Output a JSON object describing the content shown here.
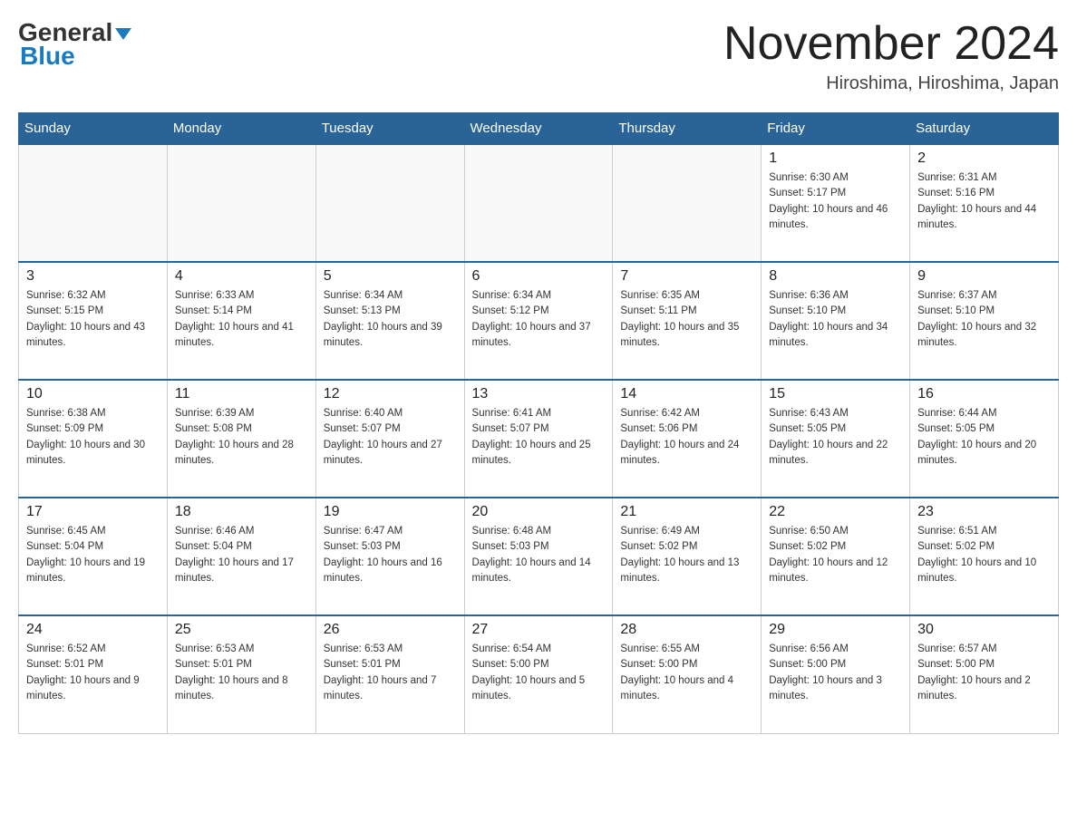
{
  "header": {
    "logo_general": "General",
    "logo_blue": "Blue",
    "month_title": "November 2024",
    "location": "Hiroshima, Hiroshima, Japan"
  },
  "days_of_week": [
    "Sunday",
    "Monday",
    "Tuesday",
    "Wednesday",
    "Thursday",
    "Friday",
    "Saturday"
  ],
  "weeks": [
    {
      "days": [
        {
          "number": "",
          "sunrise": "",
          "sunset": "",
          "daylight": "",
          "empty": true
        },
        {
          "number": "",
          "sunrise": "",
          "sunset": "",
          "daylight": "",
          "empty": true
        },
        {
          "number": "",
          "sunrise": "",
          "sunset": "",
          "daylight": "",
          "empty": true
        },
        {
          "number": "",
          "sunrise": "",
          "sunset": "",
          "daylight": "",
          "empty": true
        },
        {
          "number": "",
          "sunrise": "",
          "sunset": "",
          "daylight": "",
          "empty": true
        },
        {
          "number": "1",
          "sunrise": "Sunrise: 6:30 AM",
          "sunset": "Sunset: 5:17 PM",
          "daylight": "Daylight: 10 hours and 46 minutes.",
          "empty": false
        },
        {
          "number": "2",
          "sunrise": "Sunrise: 6:31 AM",
          "sunset": "Sunset: 5:16 PM",
          "daylight": "Daylight: 10 hours and 44 minutes.",
          "empty": false
        }
      ]
    },
    {
      "days": [
        {
          "number": "3",
          "sunrise": "Sunrise: 6:32 AM",
          "sunset": "Sunset: 5:15 PM",
          "daylight": "Daylight: 10 hours and 43 minutes.",
          "empty": false
        },
        {
          "number": "4",
          "sunrise": "Sunrise: 6:33 AM",
          "sunset": "Sunset: 5:14 PM",
          "daylight": "Daylight: 10 hours and 41 minutes.",
          "empty": false
        },
        {
          "number": "5",
          "sunrise": "Sunrise: 6:34 AM",
          "sunset": "Sunset: 5:13 PM",
          "daylight": "Daylight: 10 hours and 39 minutes.",
          "empty": false
        },
        {
          "number": "6",
          "sunrise": "Sunrise: 6:34 AM",
          "sunset": "Sunset: 5:12 PM",
          "daylight": "Daylight: 10 hours and 37 minutes.",
          "empty": false
        },
        {
          "number": "7",
          "sunrise": "Sunrise: 6:35 AM",
          "sunset": "Sunset: 5:11 PM",
          "daylight": "Daylight: 10 hours and 35 minutes.",
          "empty": false
        },
        {
          "number": "8",
          "sunrise": "Sunrise: 6:36 AM",
          "sunset": "Sunset: 5:10 PM",
          "daylight": "Daylight: 10 hours and 34 minutes.",
          "empty": false
        },
        {
          "number": "9",
          "sunrise": "Sunrise: 6:37 AM",
          "sunset": "Sunset: 5:10 PM",
          "daylight": "Daylight: 10 hours and 32 minutes.",
          "empty": false
        }
      ]
    },
    {
      "days": [
        {
          "number": "10",
          "sunrise": "Sunrise: 6:38 AM",
          "sunset": "Sunset: 5:09 PM",
          "daylight": "Daylight: 10 hours and 30 minutes.",
          "empty": false
        },
        {
          "number": "11",
          "sunrise": "Sunrise: 6:39 AM",
          "sunset": "Sunset: 5:08 PM",
          "daylight": "Daylight: 10 hours and 28 minutes.",
          "empty": false
        },
        {
          "number": "12",
          "sunrise": "Sunrise: 6:40 AM",
          "sunset": "Sunset: 5:07 PM",
          "daylight": "Daylight: 10 hours and 27 minutes.",
          "empty": false
        },
        {
          "number": "13",
          "sunrise": "Sunrise: 6:41 AM",
          "sunset": "Sunset: 5:07 PM",
          "daylight": "Daylight: 10 hours and 25 minutes.",
          "empty": false
        },
        {
          "number": "14",
          "sunrise": "Sunrise: 6:42 AM",
          "sunset": "Sunset: 5:06 PM",
          "daylight": "Daylight: 10 hours and 24 minutes.",
          "empty": false
        },
        {
          "number": "15",
          "sunrise": "Sunrise: 6:43 AM",
          "sunset": "Sunset: 5:05 PM",
          "daylight": "Daylight: 10 hours and 22 minutes.",
          "empty": false
        },
        {
          "number": "16",
          "sunrise": "Sunrise: 6:44 AM",
          "sunset": "Sunset: 5:05 PM",
          "daylight": "Daylight: 10 hours and 20 minutes.",
          "empty": false
        }
      ]
    },
    {
      "days": [
        {
          "number": "17",
          "sunrise": "Sunrise: 6:45 AM",
          "sunset": "Sunset: 5:04 PM",
          "daylight": "Daylight: 10 hours and 19 minutes.",
          "empty": false
        },
        {
          "number": "18",
          "sunrise": "Sunrise: 6:46 AM",
          "sunset": "Sunset: 5:04 PM",
          "daylight": "Daylight: 10 hours and 17 minutes.",
          "empty": false
        },
        {
          "number": "19",
          "sunrise": "Sunrise: 6:47 AM",
          "sunset": "Sunset: 5:03 PM",
          "daylight": "Daylight: 10 hours and 16 minutes.",
          "empty": false
        },
        {
          "number": "20",
          "sunrise": "Sunrise: 6:48 AM",
          "sunset": "Sunset: 5:03 PM",
          "daylight": "Daylight: 10 hours and 14 minutes.",
          "empty": false
        },
        {
          "number": "21",
          "sunrise": "Sunrise: 6:49 AM",
          "sunset": "Sunset: 5:02 PM",
          "daylight": "Daylight: 10 hours and 13 minutes.",
          "empty": false
        },
        {
          "number": "22",
          "sunrise": "Sunrise: 6:50 AM",
          "sunset": "Sunset: 5:02 PM",
          "daylight": "Daylight: 10 hours and 12 minutes.",
          "empty": false
        },
        {
          "number": "23",
          "sunrise": "Sunrise: 6:51 AM",
          "sunset": "Sunset: 5:02 PM",
          "daylight": "Daylight: 10 hours and 10 minutes.",
          "empty": false
        }
      ]
    },
    {
      "days": [
        {
          "number": "24",
          "sunrise": "Sunrise: 6:52 AM",
          "sunset": "Sunset: 5:01 PM",
          "daylight": "Daylight: 10 hours and 9 minutes.",
          "empty": false
        },
        {
          "number": "25",
          "sunrise": "Sunrise: 6:53 AM",
          "sunset": "Sunset: 5:01 PM",
          "daylight": "Daylight: 10 hours and 8 minutes.",
          "empty": false
        },
        {
          "number": "26",
          "sunrise": "Sunrise: 6:53 AM",
          "sunset": "Sunset: 5:01 PM",
          "daylight": "Daylight: 10 hours and 7 minutes.",
          "empty": false
        },
        {
          "number": "27",
          "sunrise": "Sunrise: 6:54 AM",
          "sunset": "Sunset: 5:00 PM",
          "daylight": "Daylight: 10 hours and 5 minutes.",
          "empty": false
        },
        {
          "number": "28",
          "sunrise": "Sunrise: 6:55 AM",
          "sunset": "Sunset: 5:00 PM",
          "daylight": "Daylight: 10 hours and 4 minutes.",
          "empty": false
        },
        {
          "number": "29",
          "sunrise": "Sunrise: 6:56 AM",
          "sunset": "Sunset: 5:00 PM",
          "daylight": "Daylight: 10 hours and 3 minutes.",
          "empty": false
        },
        {
          "number": "30",
          "sunrise": "Sunrise: 6:57 AM",
          "sunset": "Sunset: 5:00 PM",
          "daylight": "Daylight: 10 hours and 2 minutes.",
          "empty": false
        }
      ]
    }
  ]
}
